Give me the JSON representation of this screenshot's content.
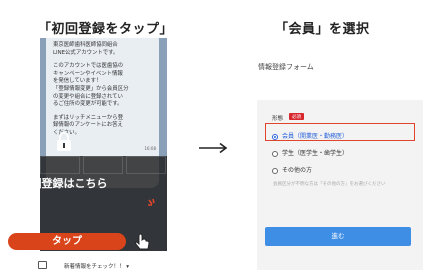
{
  "captions": {
    "left": "「初回登録をタップ」",
    "right": "「会員」を選択"
  },
  "left_screen": {
    "chat_paragraphs": [
      "東京医師歯科医師協同組合\nLINE公式アカウントです。",
      "このアカウントでは医歯協の\nキャンペーンやイベント情報\nを発信しています！\n「登録情報変更」から会員区分\nの変更や組合に登録されてい\nるご住所の変更が可能です。",
      "まずはリッチメニューから登\n録情報のアンケートにお答え\nください。"
    ],
    "message_time": "16:08",
    "first_registration_label": "初回登録はこちら",
    "tap_button_label": "タップ",
    "bottom_bar_text": "新着情報をチェック！！ ▾"
  },
  "form": {
    "title": "情報登録フォーム",
    "type_label": "形態",
    "required_badge": "必須",
    "options": [
      {
        "label": "会員（開業医・勤務医）",
        "selected": true
      },
      {
        "label": "学生（医学生・歯学生）",
        "selected": false
      },
      {
        "label": "その他の方",
        "selected": false
      }
    ],
    "other_note": "会員区分が不明な方は「その他の方」をお選びください",
    "next_button_label": "進む"
  },
  "colors": {
    "accent_red": "#d9441a",
    "highlight_red": "#e0452b",
    "required_red": "#d9272e",
    "primary_blue": "#3f8ee6"
  }
}
